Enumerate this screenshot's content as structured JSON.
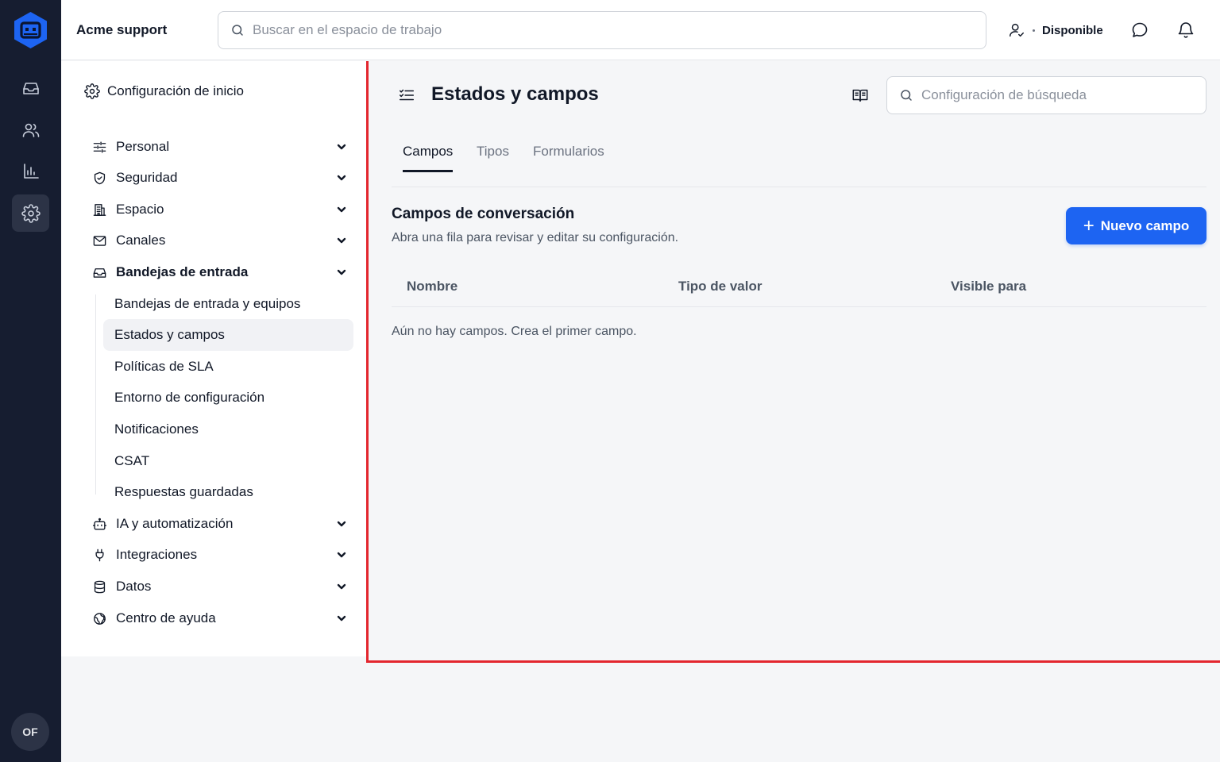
{
  "app": {
    "workspace_name": "Acme support",
    "brand_color": "#1d64f2",
    "rail_color": "#161d30"
  },
  "rail": {
    "items": [
      {
        "icon": "inbox-icon"
      },
      {
        "icon": "users-icon"
      },
      {
        "icon": "bar-chart-icon"
      },
      {
        "icon": "gear-icon",
        "active": true
      }
    ],
    "avatar_initials": "OF"
  },
  "topbar": {
    "search_placeholder": "Buscar en el espacio de trabajo",
    "status_label": "Disponible"
  },
  "settings_nav": {
    "home_label": "Configuración de inicio",
    "sections": [
      {
        "label": "Personal",
        "icon": "sliders-icon"
      },
      {
        "label": "Seguridad",
        "icon": "shield-icon"
      },
      {
        "label": "Espacio",
        "icon": "building-icon"
      },
      {
        "label": "Canales",
        "icon": "mail-icon"
      },
      {
        "label": "Bandejas de entrada",
        "icon": "inbox-icon",
        "expanded": true
      },
      {
        "label": "IA y automatización",
        "icon": "bot-icon"
      },
      {
        "label": "Integraciones",
        "icon": "plug-icon"
      },
      {
        "label": "Datos",
        "icon": "database-icon"
      },
      {
        "label": "Centro de ayuda",
        "icon": "globe-icon"
      }
    ],
    "sub_items": [
      {
        "label": "Bandejas de entrada y equipos"
      },
      {
        "label": "Estados y campos",
        "active": true
      },
      {
        "label": "Políticas de SLA"
      },
      {
        "label": "Entorno de configuración"
      },
      {
        "label": "Notificaciones"
      },
      {
        "label": "CSAT"
      },
      {
        "label": "Respuestas guardadas"
      }
    ]
  },
  "main": {
    "title": "Estados y campos",
    "search_placeholder": "Configuración de búsqueda",
    "tabs": [
      {
        "label": "Campos",
        "active": true
      },
      {
        "label": "Tipos"
      },
      {
        "label": "Formularios"
      }
    ],
    "section_title": "Campos de conversación",
    "section_desc": "Abra una fila para revisar y editar su configuración.",
    "new_button_label": "Nuevo campo",
    "table": {
      "columns": [
        "Nombre",
        "Tipo de valor",
        "Visible para"
      ],
      "empty_text": "Aún no hay campos. Crea el primer campo."
    }
  }
}
